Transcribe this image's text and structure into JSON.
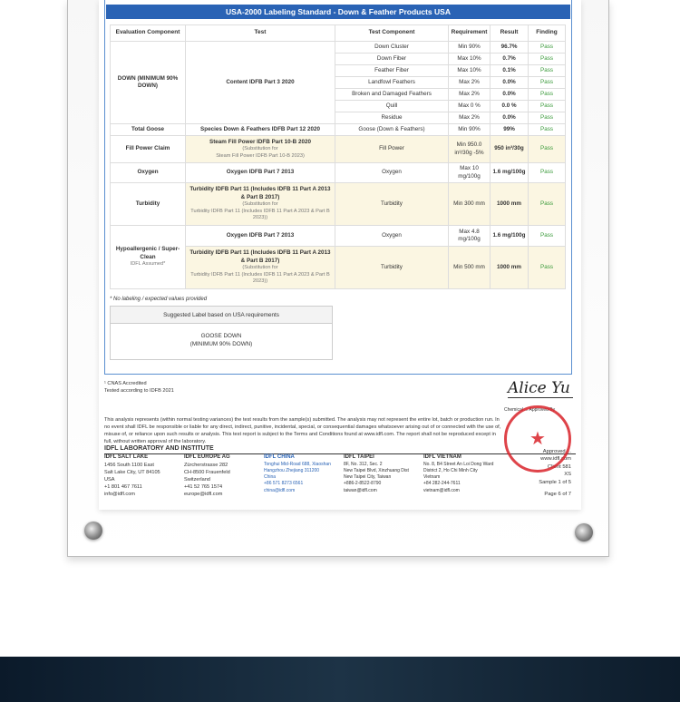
{
  "title": "USA-2000 Labeling Standard - Down & Feather Products USA",
  "headers": [
    "Evaluation Component",
    "Test",
    "Test Component",
    "Requirement",
    "Result",
    "Finding"
  ],
  "down": {
    "component": "DOWN (MINIMUM 90% DOWN)",
    "test": "Content IDFB Part 3 2020",
    "rows": [
      [
        "Down Cluster",
        "Min 90%",
        "96.7%",
        "Pass"
      ],
      [
        "Down Fiber",
        "Max 10%",
        "0.7%",
        "Pass"
      ],
      [
        "Feather Fiber",
        "Max 10%",
        "0.1%",
        "Pass"
      ],
      [
        "Landfowl Feathers",
        "Max 2%",
        "0.0%",
        "Pass"
      ],
      [
        "Broken and Damaged Feathers",
        "Max 2%",
        "0.0%",
        "Pass"
      ],
      [
        "Quill",
        "Max 0 %",
        "0.0 %",
        "Pass"
      ],
      [
        "Residue",
        "Max 2%",
        "0.0%",
        "Pass"
      ]
    ]
  },
  "goose": [
    "Total Goose",
    "Species Down & Feathers IDFB Part 12 2020",
    "Goose (Down & Feathers)",
    "Min 90%",
    "99%",
    "Pass"
  ],
  "fill": {
    "component": "Fill Power Claim",
    "test": "Steam Fill Power IDFB Part 10-B 2020",
    "sub1": "(Substitution for",
    "sub2": "Steam Fill Power IDFB Part 10-B 2023)",
    "tc": "Fill Power",
    "req": "Min 950.0 in³/30g -5%",
    "res": "950 in³/30g",
    "find": "Pass"
  },
  "oxygen": [
    "Oxygen",
    "Oxygen IDFB Part 7 2013",
    "Oxygen",
    "Max 10 mg/100g",
    "1.6 mg/100g",
    "Pass"
  ],
  "turb": {
    "component": "Turbidity",
    "test": "Turbidity IDFB Part 11 (Includes IDFB 11 Part A 2013 & Part B 2017)",
    "sub1": "(Substitution for",
    "sub2": "Turbidity IDFB Part 11 (Includes IDFB 11 Part A 2023 & Part B 2023))",
    "tc": "Turbidity",
    "req": "Min 300 mm",
    "res": "1000 mm",
    "find": "Pass"
  },
  "hypo": {
    "component": "Hypoallergenic / Super-Clean",
    "assumed": "IDFL Assumed*",
    "oxy": [
      "Oxygen IDFB Part 7 2013",
      "Oxygen",
      "Max 4.8 mg/100g",
      "1.6 mg/100g",
      "Pass"
    ],
    "turb": {
      "test": "Turbidity IDFB Part 11 (Includes IDFB 11 Part A 2013 & Part B 2017)",
      "sub1": "(Substitution for",
      "sub2": "Turbidity IDFB Part 11 (Includes IDFB 11 Part A 2023 & Part B 2023))",
      "tc": "Turbidity",
      "req": "Min 500 mm",
      "res": "1000 mm",
      "find": "Pass"
    }
  },
  "note": "* No labeling / expected values provided",
  "suggested": {
    "header": "Suggested Label based on USA requirements",
    "line1": "GOOSE DOWN",
    "line2": "(MINIMUM 90% DOWN)"
  },
  "accred": "¹ CNAS Accredited",
  "tested": "Tested according to IDFB 2021",
  "disclaimer": "This analysis represents (within normal testing variances) the test results from the sample(s) submitted. The analysis may not represent the entire lot, batch or production run. In no event shall IDFL be responsible or liable for any direct, indirect, punitive, incidental, special, or consequential damages whatsoever arising out of or connected with the use of, misuse of, or reliance upon such results or analysis. This test report is subject to the Terms and Conditions found at www.idfl.com. The report shall not be reproduced except in full, without written approval of the laboratory.",
  "lab_name": "IDFL LABORATORY AND INSTITUTE",
  "offices": [
    {
      "name": "IDFL SALT LAKE",
      "lines": [
        "1456 South 1100 East",
        "Salt Lake City, UT 84105",
        "USA",
        "+1 801 467 7611",
        "info@idfl.com"
      ]
    },
    {
      "name": "IDFL EUROPE AG",
      "lines": [
        "Zürcherstrasse 282",
        "CH-8500 Frauenfeld",
        "Switzerland",
        "+41 52 765 1574",
        "europe@idfl.com"
      ]
    },
    {
      "name": "IDFL CHINA",
      "lines": [
        "Tonghui Mid-Road 688, Xiaoshan",
        "Hangzhou Zhejiang 311200",
        "China",
        "+86 571 8273 6561",
        "china@idfl.com"
      ]
    },
    {
      "name": "IDFL TAIPEI",
      "lines": [
        "8F, No. 312, Sec. 2",
        "New Taipei Blvd, Xinzhuang Dist",
        "New Taipei City, Taiwan",
        "+886-2-8522-8790",
        "taiwan@idfl.com"
      ]
    },
    {
      "name": "IDFL VIETNAM",
      "lines": [
        "No. 8, B4 Street An Loi Dong Ward",
        "District 2, Ho Chi Minh City",
        "Vietnam",
        "+84 282-244-7611",
        "vietnam@idfl.com"
      ]
    }
  ],
  "signature": "Alice Yu",
  "signer_label": "Chemical ... Approved By",
  "right": [
    "Approved ...",
    "www.idfl.com",
    "Client 581",
    "XS",
    "Sample 1 of 5"
  ],
  "page": "Page 6 of 7"
}
